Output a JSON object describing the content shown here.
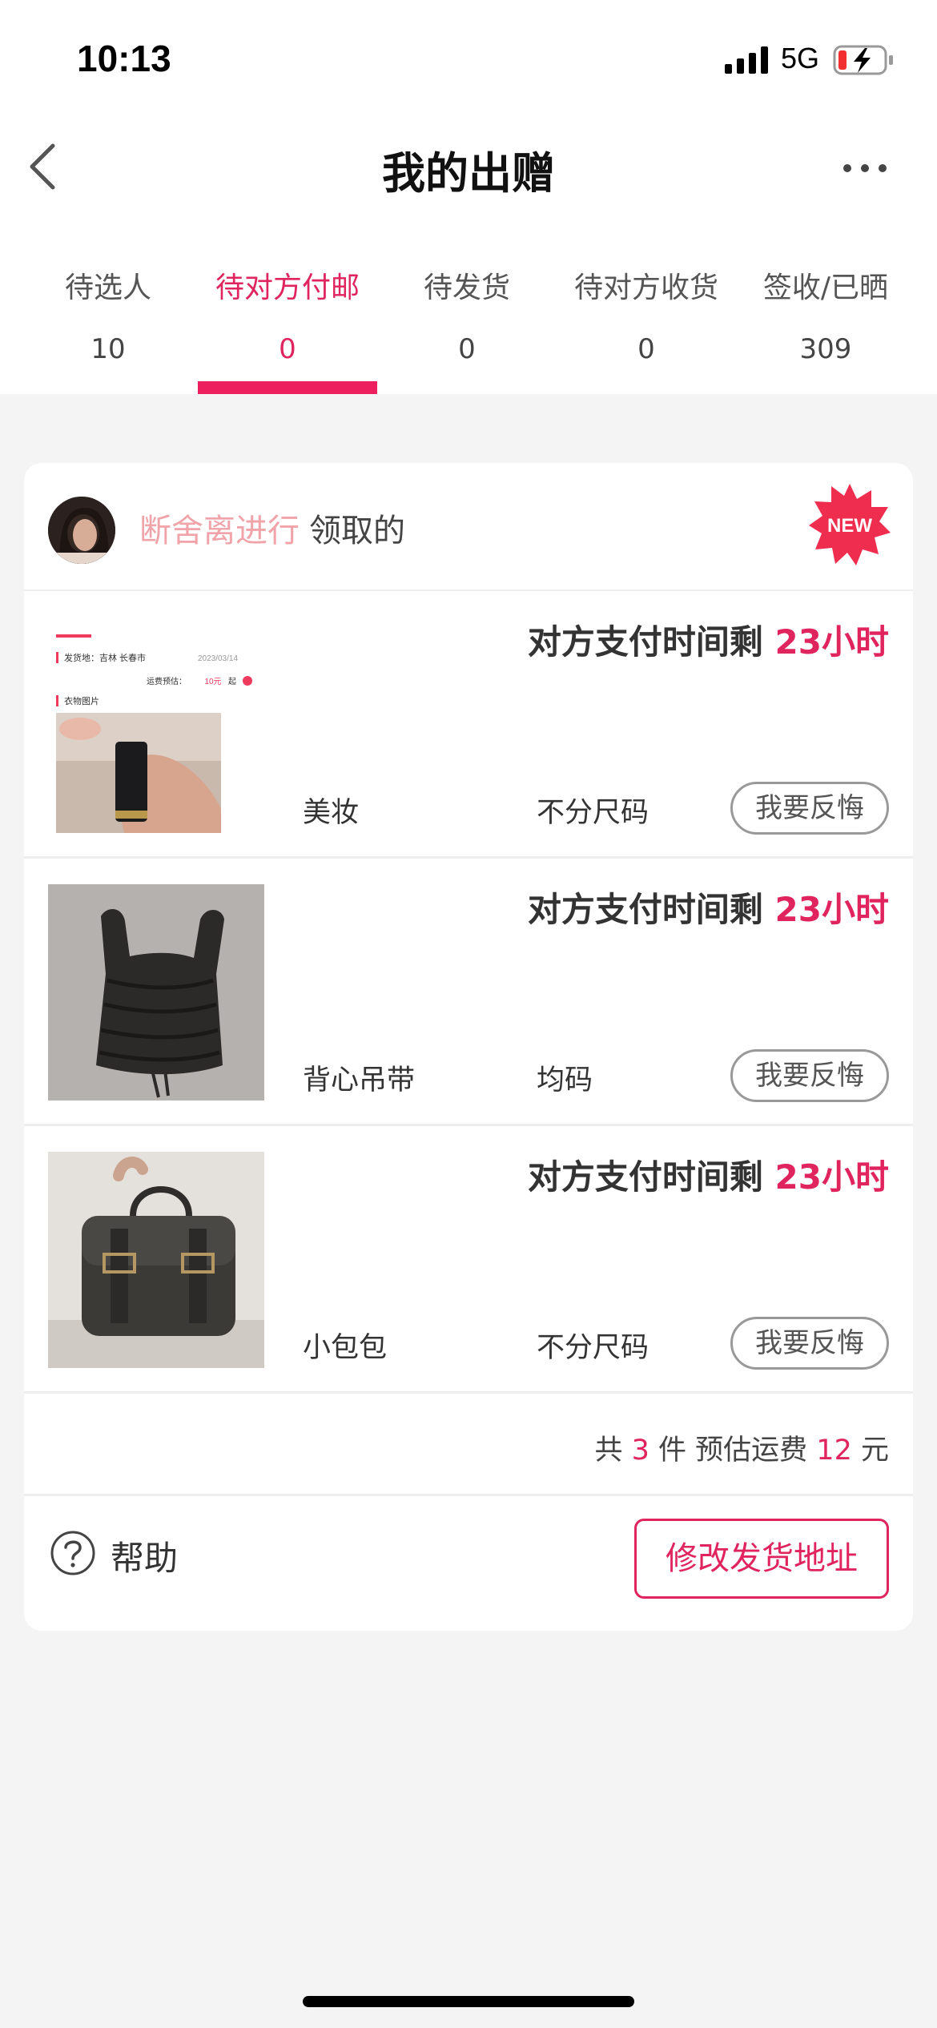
{
  "status_bar": {
    "time": "10:13",
    "network": "5G"
  },
  "nav": {
    "title": "我的出赠"
  },
  "tabs": [
    {
      "label": "待选人",
      "count": "10"
    },
    {
      "label": "待对方付邮",
      "count": "0"
    },
    {
      "label": "待发货",
      "count": "0"
    },
    {
      "label": "待对方收货",
      "count": "0"
    },
    {
      "label": "签收/已晒",
      "count": "309"
    }
  ],
  "active_tab_index": 1,
  "card": {
    "giver_name": "断舍离进行",
    "claimed_text": "领取的",
    "new_badge": "NEW",
    "items": [
      {
        "countdown_prefix": "对方支付时间剩",
        "countdown_hours": "23小时",
        "name": "美妆",
        "size": "不分尺码",
        "regret_label": "我要反悔",
        "thumb_text": {
          "origin_label": "发货地：",
          "origin_value": "吉林 长春市",
          "date": "2023/03/14",
          "shipping_label": "运费预估：",
          "shipping_value": "10元",
          "shipping_suffix": "起",
          "section": "衣物图片"
        }
      },
      {
        "countdown_prefix": "对方支付时间剩",
        "countdown_hours": "23小时",
        "name": "背心吊带",
        "size": "均码",
        "regret_label": "我要反悔"
      },
      {
        "countdown_prefix": "对方支付时间剩",
        "countdown_hours": "23小时",
        "name": "小包包",
        "size": "不分尺码",
        "regret_label": "我要反悔"
      }
    ],
    "summary": {
      "prefix": "共",
      "count": "3",
      "unit": "件 预估运费",
      "fee": "12",
      "currency": "元"
    },
    "help_label": "帮助",
    "address_button": "修改发货地址"
  },
  "colors": {
    "accent": "#e0245e",
    "giver_name": "#f0a3a8"
  }
}
